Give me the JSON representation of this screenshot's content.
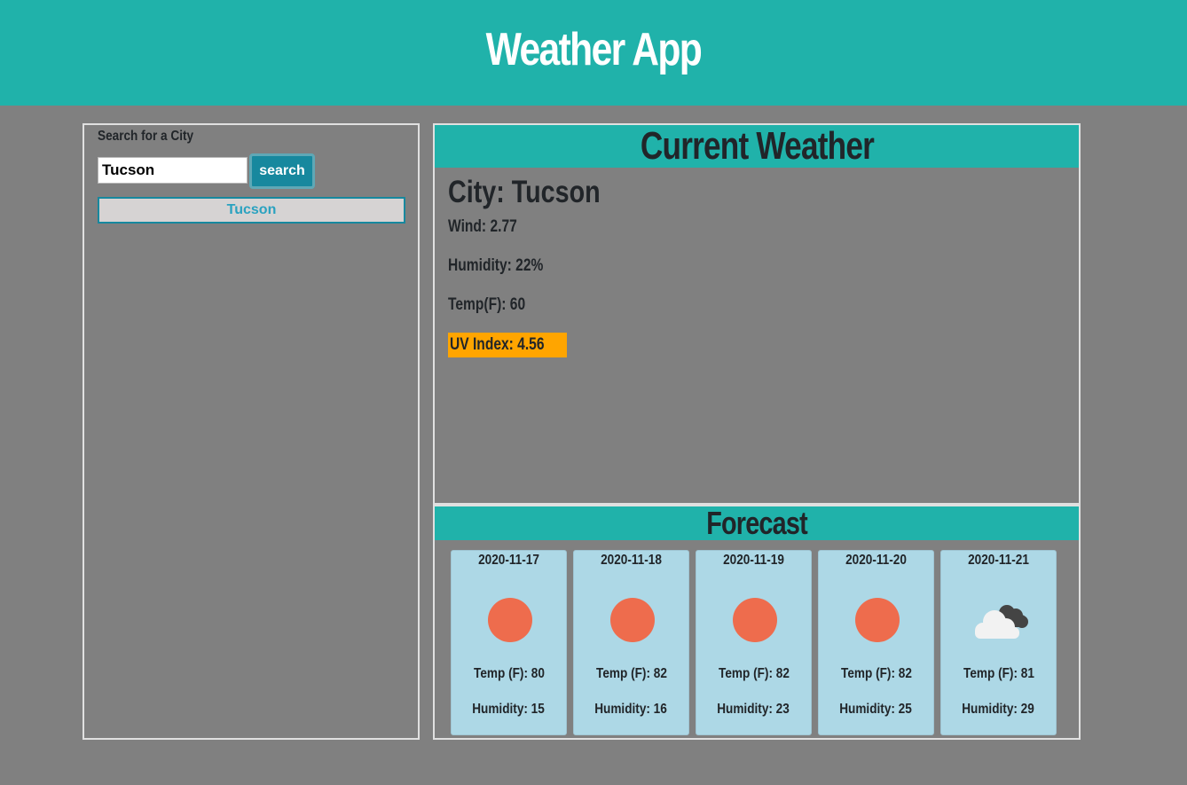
{
  "header": {
    "title": "Weather App"
  },
  "search": {
    "label": "Search for a City",
    "input_value": "Tucson",
    "button_label": "search",
    "history": [
      "Tucson"
    ]
  },
  "current": {
    "heading": "Current Weather",
    "city": "City: Tucson",
    "wind": "Wind: 2.77",
    "humidity": "Humidity: 22%",
    "temp": "Temp(F): 60",
    "uv": "UV Index: 4.56",
    "uv_color": "#ffa500"
  },
  "forecast": {
    "heading": "Forecast",
    "days": [
      {
        "date": "2020-11-17",
        "icon": "sun-icon",
        "temp": "Temp (F): 80",
        "humidity": "Humidity: 15"
      },
      {
        "date": "2020-11-18",
        "icon": "sun-icon",
        "temp": "Temp (F): 82",
        "humidity": "Humidity: 16"
      },
      {
        "date": "2020-11-19",
        "icon": "sun-icon",
        "temp": "Temp (F): 82",
        "humidity": "Humidity: 23"
      },
      {
        "date": "2020-11-20",
        "icon": "sun-icon",
        "temp": "Temp (F): 82",
        "humidity": "Humidity: 25"
      },
      {
        "date": "2020-11-21",
        "icon": "cloud-icon",
        "temp": "Temp (F): 81",
        "humidity": "Humidity: 29"
      }
    ]
  },
  "colors": {
    "accent": "#20b2aa",
    "background": "#808080",
    "button": "#17889e",
    "card": "#add8e6",
    "sun": "#ee6c4d"
  }
}
